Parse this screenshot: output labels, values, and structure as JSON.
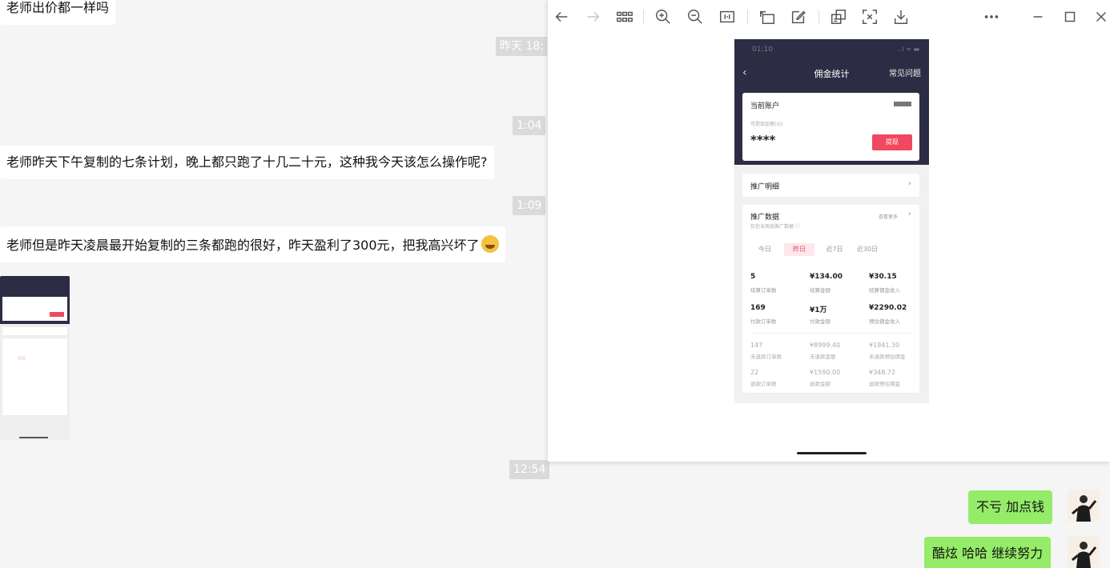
{
  "chat": {
    "msg_top": "老师出价都一样吗",
    "ts_1": "昨天 18:",
    "ts_2": "1:04",
    "msg_1": "老师昨天下午复制的七条计划，晚上都只跑了十几二十元，这种我今天该怎么操作呢?",
    "ts_3": "1:09",
    "msg_2": "老师但是昨天凌晨最开始复制的三条都跑的很好，昨天盈利了300元，把我高兴坏了",
    "ts_4": "12:54",
    "reply_1": "不亏 加点钱",
    "reply_2": "酷炫 哈哈 继续努力"
  },
  "viewer": {
    "toolbar": [
      "back-icon",
      "forward-icon",
      "grid-icon",
      "zoom-in-icon",
      "zoom-out-icon",
      "fit-icon",
      "rotate-icon",
      "edit-icon",
      "ocr-icon",
      "scan-icon",
      "download-icon",
      "more-icon",
      "minimize-icon",
      "maximize-icon",
      "close-icon"
    ]
  },
  "phone": {
    "status_time": "01:10",
    "status_right": "..l ≈ ▬",
    "title": "佣金统计",
    "help": "常见问题",
    "account_label": "当前账户",
    "withdrawable_label": "可提现金额(元)",
    "masked_amount": "****",
    "withdraw_button": "提现",
    "promo_detail": "推广明细",
    "promo_data": "推广数据",
    "more": "查看更多",
    "promo_sub": "仅包含商品推广数据 ⓘ",
    "tabs": [
      "今日",
      "昨日",
      "近7日",
      "近30日"
    ],
    "active_tab": 1,
    "stats": [
      {
        "value": "5",
        "caption": "结算订单数"
      },
      {
        "value": "¥134.00",
        "caption": "结算金额"
      },
      {
        "value": "¥30.15",
        "caption": "结算佣金收入"
      },
      {
        "value": "169",
        "caption": "付款订单数"
      },
      {
        "value": "¥1万",
        "caption": "付款金额"
      },
      {
        "value": "¥2290.02",
        "caption": "预估佣金收入"
      }
    ],
    "minor_stats": [
      {
        "value": "147",
        "caption": "未退款订单数"
      },
      {
        "value": "¥8999.40",
        "caption": "未退款金额"
      },
      {
        "value": "¥1941.30",
        "caption": "未退款预估佣金"
      },
      {
        "value": "22",
        "caption": "退款订单数"
      },
      {
        "value": "¥1590.00",
        "caption": "退款金额"
      },
      {
        "value": "¥348.72",
        "caption": "退款预估佣金"
      }
    ]
  },
  "colors": {
    "bubble_green": "#95ec69",
    "phone_header": "#2c2d44",
    "accent_red": "#f04860"
  }
}
